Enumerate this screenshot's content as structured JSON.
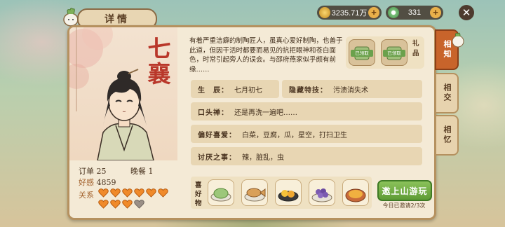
{
  "header": {
    "title": "详情"
  },
  "resources": [
    {
      "icon": "gold-coin-icon",
      "value": "3235.71万"
    },
    {
      "icon": "jade-coin-icon",
      "value": "331"
    }
  ],
  "character": {
    "name": "七\n襄",
    "description": "有着严重洁癖的制陶匠人，虽真心爱好制陶，也善于此道，但因干活时都要而易见的抗拒眼神和苍白面色，时常引起旁人的误会。与邵府燕家似乎颇有前缘……",
    "orders_label": "订单",
    "orders_value": "25",
    "dinner_label": "晚餐",
    "dinner_value": "1",
    "affinity_label": "好感",
    "affinity_value": "4859",
    "relation_label": "关系",
    "hearts_filled": 9,
    "hearts_total": 10
  },
  "gifts": {
    "label": "礼品",
    "items": [
      {
        "tag": "已领取"
      },
      {
        "tag": "已领取"
      }
    ]
  },
  "info": {
    "birthday_label": "生　辰：",
    "birthday_value": "七月初七",
    "trait_label": "隐藏特技：",
    "trait_value": "污渍消失术",
    "catchphrase_label": "口头禅：",
    "catchphrase_value": "还是再洗一遍吧……",
    "hobby_label": "偏好喜爱：",
    "hobby_value": "白菜，豆腐，瓜，星空，打扫卫生",
    "dislike_label": "讨厌之事：",
    "dislike_value": "辣，脏乱，虫"
  },
  "likes": {
    "label": "喜好物",
    "items": [
      "cabbage-dish-icon",
      "fish-dish-icon",
      "egg-dish-icon",
      "grape-dish-icon",
      "tofu-dish-icon"
    ]
  },
  "invite": {
    "label": "邀上山游玩",
    "note": "今日已邀请2/3次"
  },
  "tabs": [
    "相知",
    "相交",
    "相忆"
  ],
  "colors": {
    "accent": "#c8642b",
    "brand_green": "#5e9b35",
    "name_red": "#b9372a"
  }
}
